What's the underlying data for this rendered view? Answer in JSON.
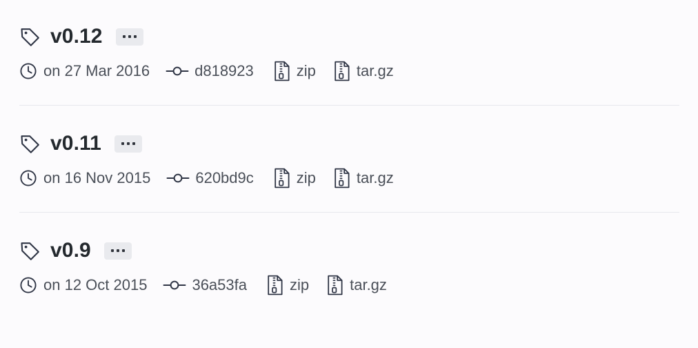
{
  "page": {
    "background_color": "#fcfbfd",
    "title_color": "#24292e",
    "meta_color": "#4a4f58",
    "divider_color": "#e7e7ed",
    "badge_color": "#e9eaee"
  },
  "releases": [
    {
      "version": "v0.12",
      "tag_icon": "tag-icon",
      "menu_icon": "ellipsis-icon",
      "clock_icon": "clock-icon",
      "date": "on 27 Mar 2016",
      "commit_icon": "commit-icon",
      "commit": "d818923",
      "downloads": [
        {
          "icon": "zip-file-icon",
          "label": "zip"
        },
        {
          "icon": "zip-file-icon",
          "label": "tar.gz"
        }
      ]
    },
    {
      "version": "v0.11",
      "tag_icon": "tag-icon",
      "menu_icon": "ellipsis-icon",
      "clock_icon": "clock-icon",
      "date": "on 16 Nov 2015",
      "commit_icon": "commit-icon",
      "commit": "620bd9c",
      "downloads": [
        {
          "icon": "zip-file-icon",
          "label": "zip"
        },
        {
          "icon": "zip-file-icon",
          "label": "tar.gz"
        }
      ]
    },
    {
      "version": "v0.9",
      "tag_icon": "tag-icon",
      "menu_icon": "ellipsis-icon",
      "clock_icon": "clock-icon",
      "date": "on 12 Oct 2015",
      "commit_icon": "commit-icon",
      "commit": "36a53fa",
      "downloads": [
        {
          "icon": "zip-file-icon",
          "label": "zip"
        },
        {
          "icon": "zip-file-icon",
          "label": "tar.gz"
        }
      ]
    }
  ]
}
